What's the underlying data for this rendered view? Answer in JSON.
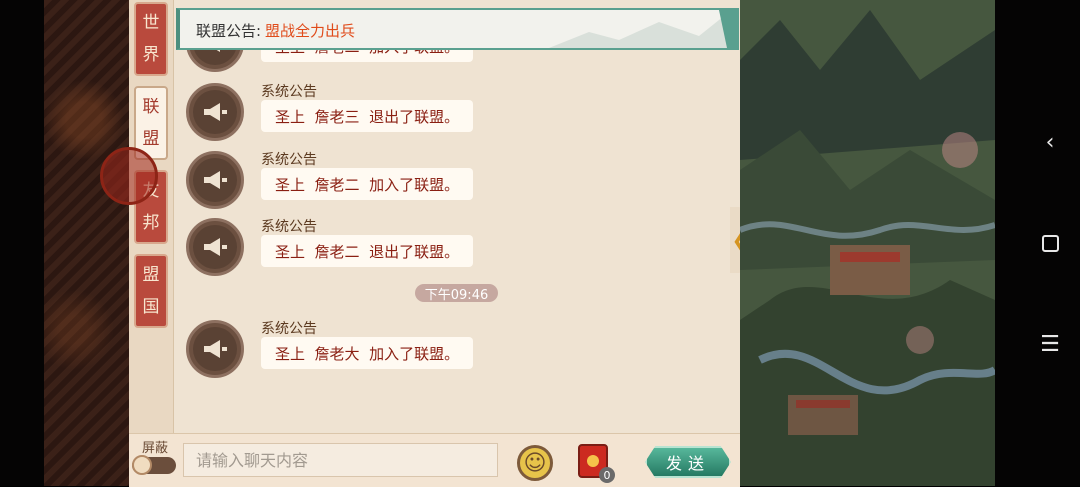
{
  "notice": {
    "label": "联盟公告:",
    "text": "盟战全力出兵"
  },
  "tabs": [
    {
      "line1": "世",
      "line2": "界"
    },
    {
      "line1": "联",
      "line2": "盟"
    },
    {
      "line1": "友",
      "line2": "邦"
    },
    {
      "line1": "盟",
      "line2": "国"
    }
  ],
  "messages": [
    {
      "sender": "系统公告",
      "text": "圣上  詹老二  加入了联盟。"
    },
    {
      "sender": "系统公告",
      "text": "圣上  詹老三  退出了联盟。"
    },
    {
      "sender": "系统公告",
      "text": "圣上  詹老二  加入了联盟。"
    },
    {
      "sender": "系统公告",
      "text": "圣上  詹老二  退出了联盟。"
    },
    {
      "sender": "系统公告",
      "text": "圣上  詹老大  加入了联盟。"
    }
  ],
  "time_separator": "下午09:46",
  "input": {
    "placeholder": "请输入聊天内容"
  },
  "shield_label": "屏蔽",
  "send_label": "发送",
  "red_packet_count": "0",
  "colors": {
    "accent_teal": "#3a937a",
    "system_text": "#8a1f12",
    "notice_text": "#e04b1a",
    "tab_red": "#b94a3d"
  }
}
